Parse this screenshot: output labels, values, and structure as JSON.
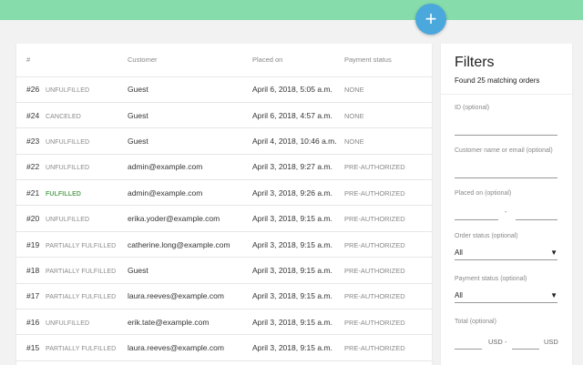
{
  "toolbar": {
    "add_label": "+"
  },
  "orders": {
    "columns": {
      "number": "#",
      "status": "",
      "customer": "Customer",
      "placed_on": "Placed on",
      "payment_status": "Payment status"
    },
    "rows": [
      {
        "number": "#26",
        "status": "UNFULFILLED",
        "customer": "Guest",
        "placed_on": "April 6, 2018, 5:05 a.m.",
        "payment": "NONE"
      },
      {
        "number": "#24",
        "status": "CANCELED",
        "customer": "Guest",
        "placed_on": "April 6, 2018, 4:57 a.m.",
        "payment": "NONE"
      },
      {
        "number": "#23",
        "status": "UNFULFILLED",
        "customer": "Guest",
        "placed_on": "April 4, 2018, 10:46 a.m.",
        "payment": "NONE"
      },
      {
        "number": "#22",
        "status": "UNFULFILLED",
        "customer": "admin@example.com",
        "placed_on": "April 3, 2018, 9:27 a.m.",
        "payment": "PRE-AUTHORIZED"
      },
      {
        "number": "#21",
        "status": "FULFILLED",
        "customer": "admin@example.com",
        "placed_on": "April 3, 2018, 9:26 a.m.",
        "payment": "PRE-AUTHORIZED"
      },
      {
        "number": "#20",
        "status": "UNFULFILLED",
        "customer": "erika.yoder@example.com",
        "placed_on": "April 3, 2018, 9:15 a.m.",
        "payment": "PRE-AUTHORIZED"
      },
      {
        "number": "#19",
        "status": "PARTIALLY FULFILLED",
        "customer": "catherine.long@example.com",
        "placed_on": "April 3, 2018, 9:15 a.m.",
        "payment": "PRE-AUTHORIZED"
      },
      {
        "number": "#18",
        "status": "PARTIALLY FULFILLED",
        "customer": "Guest",
        "placed_on": "April 3, 2018, 9:15 a.m.",
        "payment": "PRE-AUTHORIZED"
      },
      {
        "number": "#17",
        "status": "PARTIALLY FULFILLED",
        "customer": "laura.reeves@example.com",
        "placed_on": "April 3, 2018, 9:15 a.m.",
        "payment": "PRE-AUTHORIZED"
      },
      {
        "number": "#16",
        "status": "UNFULFILLED",
        "customer": "erik.tate@example.com",
        "placed_on": "April 3, 2018, 9:15 a.m.",
        "payment": "PRE-AUTHORIZED"
      },
      {
        "number": "#15",
        "status": "PARTIALLY FULFILLED",
        "customer": "laura.reeves@example.com",
        "placed_on": "April 3, 2018, 9:15 a.m.",
        "payment": "PRE-AUTHORIZED"
      }
    ]
  },
  "filters": {
    "title": "Filters",
    "count": "Found 25 matching orders",
    "id_label": "ID (optional)",
    "customer_label": "Customer name or email (optional)",
    "placed_label": "Placed on (optional)",
    "date_separator": "-",
    "order_status_label": "Order status (optional)",
    "order_status_value": "All",
    "payment_status_label": "Payment status (optional)",
    "payment_status_value": "All",
    "total_label": "Total (optional)",
    "currency": "USD",
    "total_separator": "-"
  },
  "colors": {
    "top_bar": "#86dcaa",
    "fab": "#4aa8dc",
    "fulfilled": "#5ca85c"
  }
}
